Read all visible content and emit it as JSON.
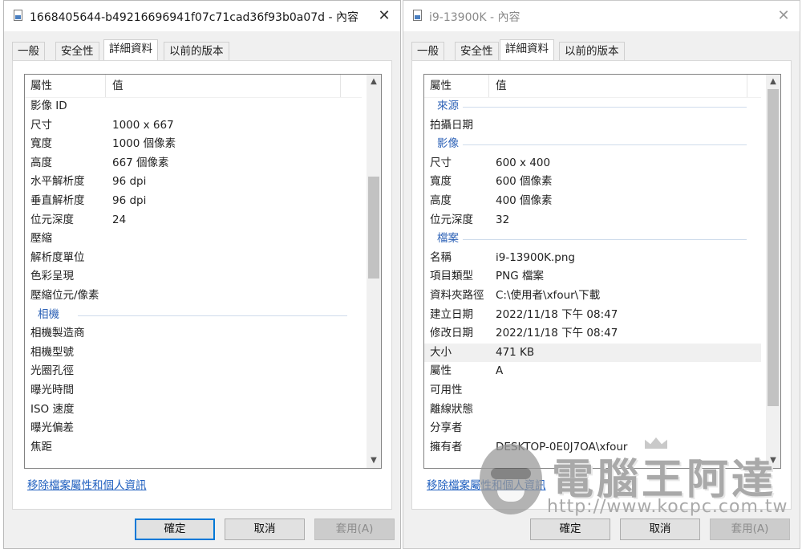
{
  "left_window": {
    "title": "1668405644-b49216696941f07c71cad36f93b0a07d - 內容",
    "close_glyph": "✕",
    "tabs": [
      {
        "label": "一般",
        "active": false
      },
      {
        "label": "安全性",
        "active": false
      },
      {
        "label": "詳細資料",
        "active": true
      },
      {
        "label": "以前的版本",
        "active": false
      }
    ],
    "header": {
      "property": "屬性",
      "value": "值"
    },
    "rows": [
      {
        "k": "影像 ID",
        "v": ""
      },
      {
        "k": "尺寸",
        "v": "1000 x 667"
      },
      {
        "k": "寬度",
        "v": "1000 個像素"
      },
      {
        "k": "高度",
        "v": "667 個像素"
      },
      {
        "k": "水平解析度",
        "v": "96 dpi"
      },
      {
        "k": "垂直解析度",
        "v": "96 dpi"
      },
      {
        "k": "位元深度",
        "v": "24"
      },
      {
        "k": "壓縮",
        "v": ""
      },
      {
        "k": "解析度單位",
        "v": ""
      },
      {
        "k": "色彩呈現",
        "v": ""
      },
      {
        "k": "壓縮位元/像素",
        "v": ""
      },
      {
        "k": "相機",
        "v": "",
        "section": true
      },
      {
        "k": "相機製造商",
        "v": ""
      },
      {
        "k": "相機型號",
        "v": ""
      },
      {
        "k": "光圈孔徑",
        "v": ""
      },
      {
        "k": "曝光時間",
        "v": ""
      },
      {
        "k": "ISO 速度",
        "v": ""
      },
      {
        "k": "曝光偏差",
        "v": ""
      },
      {
        "k": "焦距",
        "v": ""
      }
    ],
    "scrollbar": {
      "position_fraction": 0.24,
      "visible_fraction": 0.28
    },
    "remove_link": "移除檔案屬性和個人資訊",
    "buttons": {
      "ok": "確定",
      "cancel": "取消",
      "apply": "套用(A)"
    }
  },
  "right_window": {
    "title": "i9-13900K - 內容",
    "close_glyph": "✕",
    "tabs": [
      {
        "label": "一般",
        "active": false
      },
      {
        "label": "安全性",
        "active": false
      },
      {
        "label": "詳細資料",
        "active": true
      },
      {
        "label": "以前的版本",
        "active": false
      }
    ],
    "header": {
      "property": "屬性",
      "value": "值"
    },
    "rows": [
      {
        "k": "來源",
        "v": "",
        "section": true
      },
      {
        "k": "拍攝日期",
        "v": ""
      },
      {
        "k": "影像",
        "v": "",
        "section": true
      },
      {
        "k": "尺寸",
        "v": "600 x 400"
      },
      {
        "k": "寬度",
        "v": "600 個像素"
      },
      {
        "k": "高度",
        "v": "400 個像素"
      },
      {
        "k": "位元深度",
        "v": "32"
      },
      {
        "k": "檔案",
        "v": "",
        "section": true
      },
      {
        "k": "名稱",
        "v": "i9-13900K.png"
      },
      {
        "k": "項目類型",
        "v": "PNG 檔案"
      },
      {
        "k": "資料夾路徑",
        "v": "C:\\使用者\\xfour\\下載"
      },
      {
        "k": "建立日期",
        "v": "2022/11/18 下午 08:47"
      },
      {
        "k": "修改日期",
        "v": "2022/11/18 下午 08:47"
      },
      {
        "k": "大小",
        "v": "471 KB",
        "selected": true
      },
      {
        "k": "屬性",
        "v": "A"
      },
      {
        "k": "可用性",
        "v": ""
      },
      {
        "k": "離線狀態",
        "v": ""
      },
      {
        "k": "分享者",
        "v": ""
      },
      {
        "k": "擁有者",
        "v": "DESKTOP-0E0J7OA\\xfour"
      }
    ],
    "scrollbar": {
      "position_fraction": 0.0,
      "visible_fraction": 0.87
    },
    "remove_link": "移除檔案屬性和個人資訊",
    "buttons": {
      "ok": "確定",
      "cancel": "取消",
      "apply": "套用(A)"
    }
  },
  "watermark": {
    "title": "電腦王阿達",
    "url": "http://www.kocpc.com.tw"
  },
  "colors": {
    "section": "#2f63b7",
    "link": "#1f5fbf",
    "default_button_border": "#0078d7"
  }
}
